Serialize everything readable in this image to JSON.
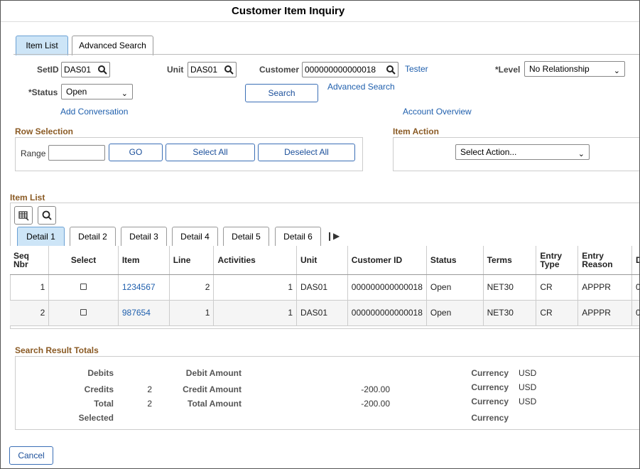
{
  "page": {
    "title": "Customer Item Inquiry"
  },
  "tabs": [
    {
      "label": "Item List",
      "active": true
    },
    {
      "label": "Advanced Search",
      "active": false
    }
  ],
  "form": {
    "setid_label": "SetID",
    "setid_value": "DAS01",
    "unit_label": "Unit",
    "unit_value": "DAS01",
    "customer_label": "Customer",
    "customer_value": "000000000000018",
    "customer_name": "Tester",
    "level_label": "*Level",
    "level_value": "No Relationship",
    "status_label": "*Status",
    "status_value": "Open",
    "search_button": "Search",
    "advanced_search_link": "Advanced Search",
    "add_conversation_link": "Add Conversation",
    "account_overview_link": "Account Overview"
  },
  "row_selection": {
    "title": "Row Selection",
    "range_label": "Range",
    "range_value": "",
    "go_button": "GO",
    "select_all_button": "Select All",
    "deselect_all_button": "Deselect All"
  },
  "item_action": {
    "title": "Item Action",
    "select_value": "Select Action..."
  },
  "item_list": {
    "title": "Item List",
    "detail_tabs": [
      "Detail 1",
      "Detail 2",
      "Detail 3",
      "Detail 4",
      "Detail 5",
      "Detail 6"
    ],
    "columns": [
      "Seq Nbr",
      "Select",
      "Item",
      "Line",
      "Activities",
      "Unit",
      "Customer ID",
      "Status",
      "Terms",
      "Entry Type",
      "Entry Reason",
      "D"
    ],
    "rows": [
      {
        "seq": "1",
        "item": "1234567",
        "line": "2",
        "activities": "1",
        "unit": "DAS01",
        "customer_id": "000000000000018",
        "status": "Open",
        "terms": "NET30",
        "entry_type": "CR",
        "entry_reason": "APPPR",
        "d": "0"
      },
      {
        "seq": "2",
        "item": "987654",
        "line": "1",
        "activities": "1",
        "unit": "DAS01",
        "customer_id": "000000000000018",
        "status": "Open",
        "terms": "NET30",
        "entry_type": "CR",
        "entry_reason": "APPPR",
        "d": "0"
      }
    ]
  },
  "totals": {
    "title": "Search Result Totals",
    "debits_label": "Debits",
    "debits_count": "",
    "debit_amount_label": "Debit Amount",
    "debit_amount": "",
    "credits_label": "Credits",
    "credits_count": "2",
    "credit_amount_label": "Credit Amount",
    "credit_amount": "-200.00",
    "total_label": "Total",
    "total_count": "2",
    "total_amount_label": "Total Amount",
    "total_amount": "-200.00",
    "selected_label": "Selected",
    "currency_label": "Currency",
    "currency_values": [
      "USD",
      "USD",
      "USD",
      ""
    ]
  },
  "footer": {
    "cancel_button": "Cancel"
  },
  "colors": {
    "accent": "#1f5fad",
    "section_header": "#8a5a24",
    "active_tab": "#cde5f7"
  }
}
